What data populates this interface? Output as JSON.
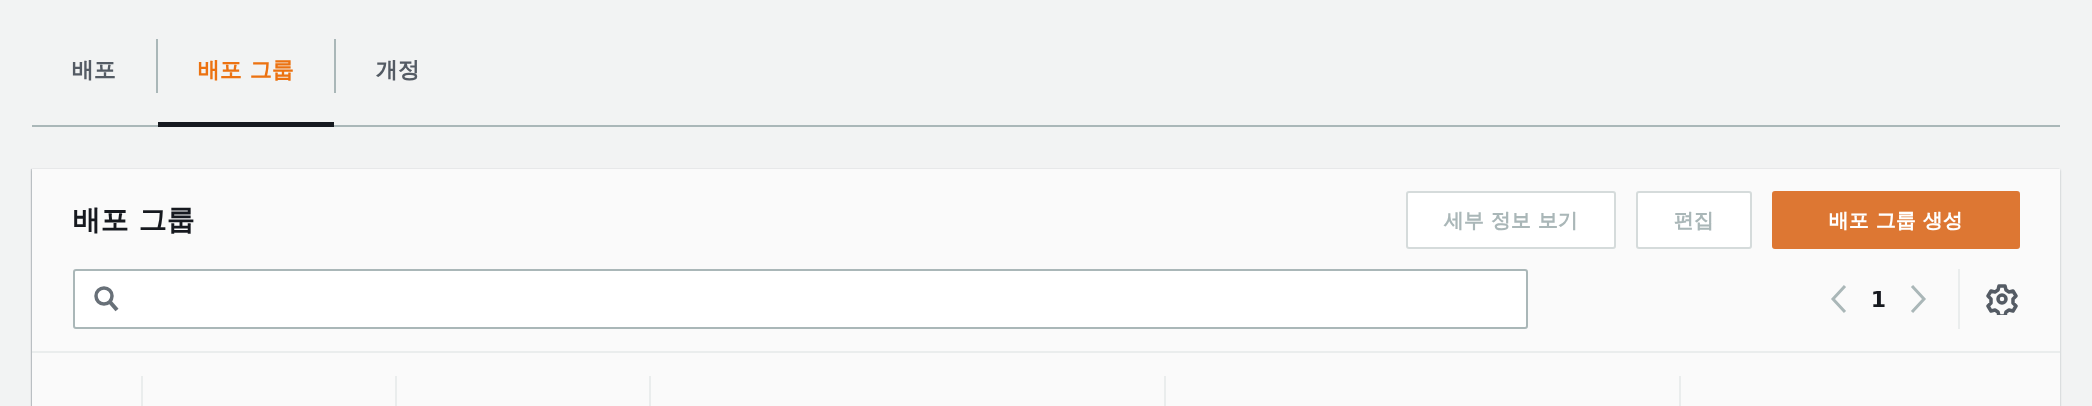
{
  "tabs": [
    {
      "label": "배포",
      "selected": false
    },
    {
      "label": "배포 그룹",
      "selected": true
    },
    {
      "label": "개정",
      "selected": false
    }
  ],
  "panel": {
    "title": "배포 그룹",
    "buttons": [
      {
        "label": "세부 정보 보기",
        "kind": "secondary",
        "disabled": true
      },
      {
        "label": "편집",
        "kind": "secondary",
        "disabled": true
      },
      {
        "label": "배포 그룹 생성",
        "kind": "primary",
        "disabled": false
      }
    ],
    "pagination": {
      "page": "1",
      "prev_disabled": true,
      "next_disabled": true
    }
  }
}
